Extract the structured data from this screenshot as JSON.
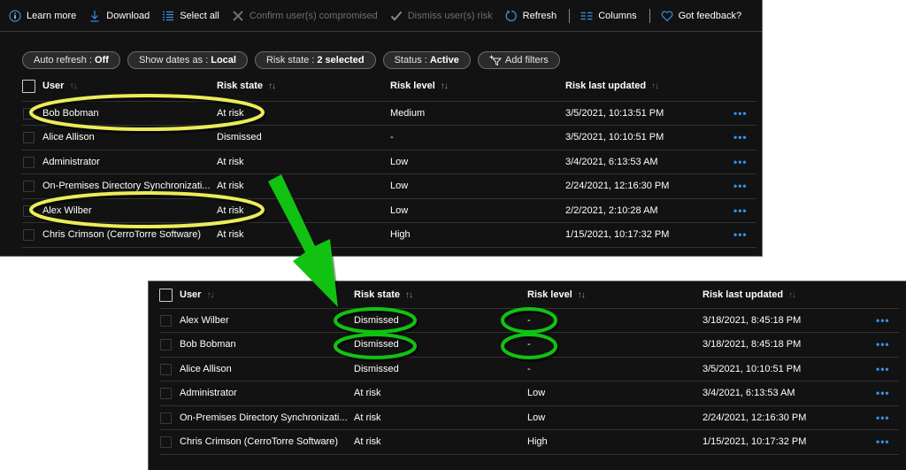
{
  "toolbar": {
    "items": [
      {
        "label": "Learn more",
        "icon": "info-icon",
        "enabled": true
      },
      {
        "label": "Download",
        "icon": "download-icon",
        "enabled": true
      },
      {
        "label": "Select all",
        "icon": "select-all-icon",
        "enabled": true
      },
      {
        "label": "Confirm user(s) compromised",
        "icon": "x-icon",
        "enabled": false
      },
      {
        "label": "Dismiss user(s) risk",
        "icon": "checkmark-icon",
        "enabled": false
      },
      {
        "label": "Refresh",
        "icon": "refresh-icon",
        "enabled": true
      },
      {
        "label": "Columns",
        "icon": "columns-icon",
        "enabled": true
      },
      {
        "label": "Got feedback?",
        "icon": "heart-icon",
        "enabled": true
      }
    ]
  },
  "filters": [
    {
      "label": "Auto refresh :",
      "value": "Off"
    },
    {
      "label": "Show dates as :",
      "value": "Local"
    },
    {
      "label": "Risk state :",
      "value": "2 selected"
    },
    {
      "label": "Status :",
      "value": "Active"
    },
    {
      "label": "Add filters",
      "value": ""
    }
  ],
  "columns": {
    "user": "User",
    "risk_state": "Risk state",
    "risk_level": "Risk level",
    "risk_last_updated": "Risk last updated",
    "sort_glyph": "↑↓",
    "more_glyph": "•••"
  },
  "before_table": {
    "rows": [
      {
        "user": "Bob Bobman",
        "risk_state": "At risk",
        "risk_level": "Medium",
        "updated": "3/5/2021, 10:13:51 PM",
        "highlighted": true
      },
      {
        "user": "Alice Allison",
        "risk_state": "Dismissed",
        "risk_level": "-",
        "updated": "3/5/2021, 10:10:51 PM",
        "highlighted": false
      },
      {
        "user": "Administrator",
        "risk_state": "At risk",
        "risk_level": "Low",
        "updated": "3/4/2021, 6:13:53 AM",
        "highlighted": false
      },
      {
        "user": "On-Premises Directory Synchronizati...",
        "risk_state": "At risk",
        "risk_level": "Low",
        "updated": "2/24/2021, 12:16:30 PM",
        "highlighted": false
      },
      {
        "user": "Alex Wilber",
        "risk_state": "At risk",
        "risk_level": "Low",
        "updated": "2/2/2021, 2:10:28 AM",
        "highlighted": true
      },
      {
        "user": "Chris Crimson (CerroTorre Software)",
        "risk_state": "At risk",
        "risk_level": "High",
        "updated": "1/15/2021, 10:17:32 PM",
        "highlighted": false
      }
    ]
  },
  "after_table": {
    "rows": [
      {
        "user": "Alex Wilber",
        "risk_state": "Dismissed",
        "risk_level": "-",
        "updated": "3/18/2021, 8:45:18 PM",
        "highlighted": true
      },
      {
        "user": "Bob Bobman",
        "risk_state": "Dismissed",
        "risk_level": "-",
        "updated": "3/18/2021, 8:45:18 PM",
        "highlighted": true
      },
      {
        "user": "Alice Allison",
        "risk_state": "Dismissed",
        "risk_level": "-",
        "updated": "3/5/2021, 10:10:51 PM",
        "highlighted": false
      },
      {
        "user": "Administrator",
        "risk_state": "At risk",
        "risk_level": "Low",
        "updated": "3/4/2021, 6:13:53 AM",
        "highlighted": false
      },
      {
        "user": "On-Premises Directory Synchronizati...",
        "risk_state": "At risk",
        "risk_level": "Low",
        "updated": "2/24/2021, 12:16:30 PM",
        "highlighted": false
      },
      {
        "user": "Chris Crimson (CerroTorre Software)",
        "risk_state": "At risk",
        "risk_level": "High",
        "updated": "1/15/2021, 10:17:32 PM",
        "highlighted": false
      }
    ]
  },
  "annotations": {
    "before_highlight_color": "#ecec5a",
    "after_highlight_color": "#12c212",
    "arrow_color": "#12c212"
  },
  "colors": {
    "background": "#121212",
    "accent": "#3a8ee6",
    "disabled": "#6f6f6f"
  }
}
